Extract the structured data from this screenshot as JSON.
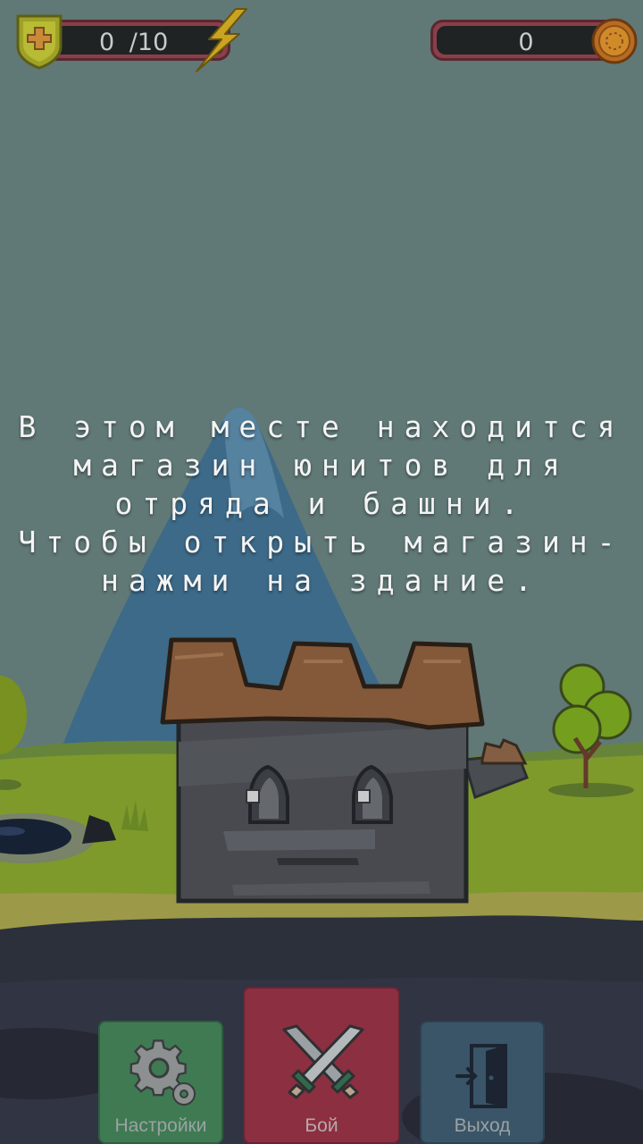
{
  "hud": {
    "energy": {
      "current": "0",
      "separator": "/",
      "max": "10",
      "add_icon": "plus-shield-icon",
      "energy_icon": "lightning-icon"
    },
    "coins": {
      "value": "0",
      "coin_icon": "coin-icon"
    }
  },
  "message": {
    "lines": [
      "В этом месте находится",
      "магазин юнитов для",
      "отряда и башни.",
      "Чтобы открыть магазин-",
      "нажми на здание."
    ]
  },
  "buttons": {
    "settings": {
      "label": "Настройки",
      "icon": "gear-icon"
    },
    "battle": {
      "label": "Бой",
      "icon": "crossed-swords-icon"
    },
    "exit": {
      "label": "Выход",
      "icon": "exit-door-icon"
    }
  },
  "colors": {
    "sky": "#657f7c",
    "grass": "#8aa82a",
    "ground": "#2f3340",
    "settings_button": "#3f7a53",
    "battle_button": "#8b2f41",
    "exit_button": "#3a5468"
  }
}
